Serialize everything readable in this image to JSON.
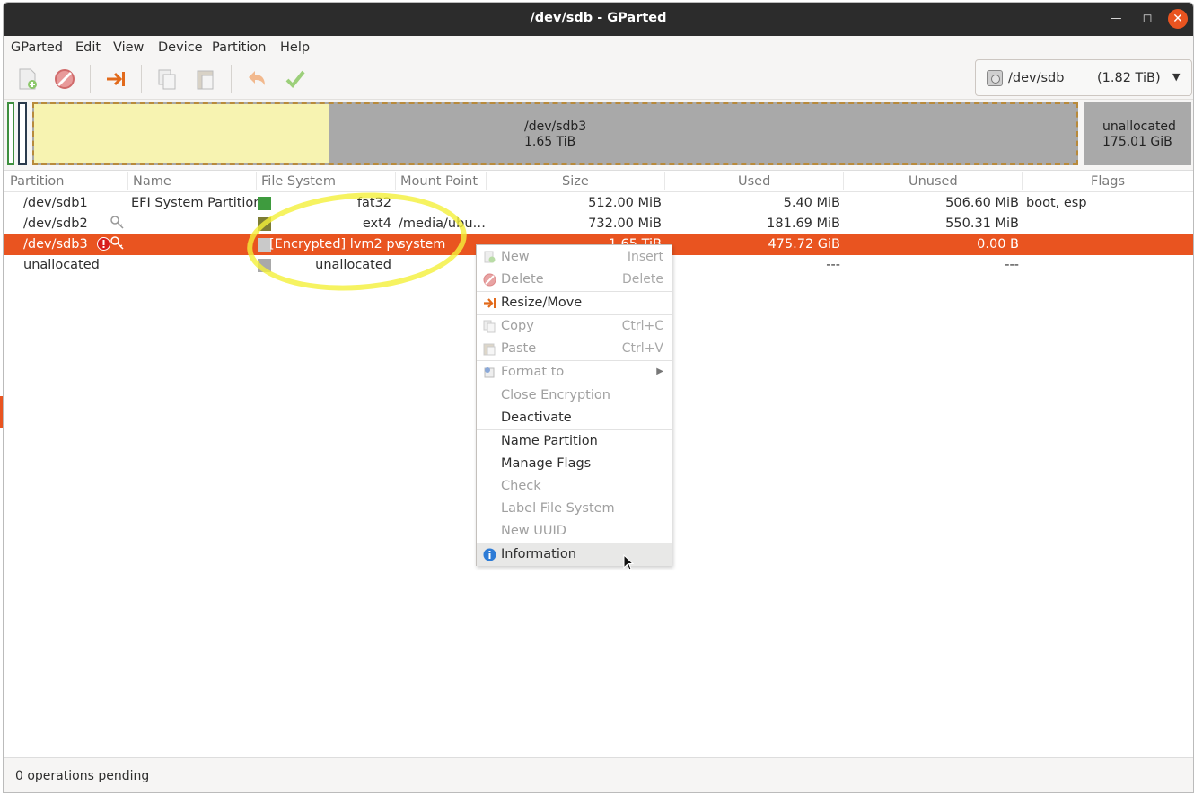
{
  "window": {
    "title": "/dev/sdb - GParted"
  },
  "menu": [
    "GParted",
    "Edit",
    "View",
    "Device",
    "Partition",
    "Help"
  ],
  "toolbar": {
    "icons": [
      "new-partition-icon",
      "delete-icon",
      "resize-move-icon",
      "copy-icon",
      "paste-icon",
      "undo-icon",
      "apply-icon"
    ],
    "device": {
      "name": "/dev/sdb",
      "size": "(1.82 TiB)"
    }
  },
  "diskmap": {
    "sdb3": {
      "name": "/dev/sdb3",
      "size": "1.65 TiB"
    },
    "unallocated": {
      "name": "unallocated",
      "size": "175.01 GiB"
    }
  },
  "columns": [
    "Partition",
    "Name",
    "File System",
    "Mount Point",
    "Size",
    "Used",
    "Unused",
    "Flags"
  ],
  "rows": [
    {
      "partition": "/dev/sdb1",
      "name": "EFI System Partition",
      "fs": "fat32",
      "fs_color": "#3e9b3e",
      "mount": "",
      "size": "512.00 MiB",
      "used": "5.40 MiB",
      "unused": "506.60 MiB",
      "flags": "boot, esp"
    },
    {
      "partition": "/dev/sdb2",
      "name": "",
      "fs": "ext4",
      "fs_color": "#7d7d35",
      "mount": "/media/ubu…",
      "size": "732.00 MiB",
      "used": "181.69 MiB",
      "unused": "550.31 MiB",
      "flags": ""
    },
    {
      "partition": "/dev/sdb3",
      "name": "",
      "fs": "[Encrypted] lvm2 pv",
      "fs_color": "#c9c9c9",
      "mount": "system",
      "size": "1.65 TiB",
      "used": "475.72 GiB",
      "unused": "0.00 B",
      "flags": ""
    },
    {
      "partition": "unallocated",
      "name": "",
      "fs": "unallocated",
      "fs_color": "#a9a9a9",
      "mount": "",
      "size": "",
      "used": "---",
      "unused": "---",
      "flags": ""
    }
  ],
  "context_menu": {
    "new": {
      "label": "New",
      "accel": "Insert"
    },
    "delete": {
      "label": "Delete",
      "accel": "Delete"
    },
    "resize": {
      "label": "Resize/Move"
    },
    "copy": {
      "label": "Copy",
      "accel": "Ctrl+C"
    },
    "paste": {
      "label": "Paste",
      "accel": "Ctrl+V"
    },
    "format": {
      "label": "Format to"
    },
    "close_enc": {
      "label": "Close Encryption"
    },
    "deactivate": {
      "label": "Deactivate"
    },
    "name_partition": {
      "label": "Name Partition"
    },
    "manage_flags": {
      "label": "Manage Flags"
    },
    "check": {
      "label": "Check"
    },
    "label_fs": {
      "label": "Label File System"
    },
    "new_uuid": {
      "label": "New UUID"
    },
    "information": {
      "label": "Information"
    }
  },
  "status": {
    "text": "0 operations pending"
  },
  "colors": {
    "accent": "#e95420",
    "highlight": "#f4f03a"
  }
}
